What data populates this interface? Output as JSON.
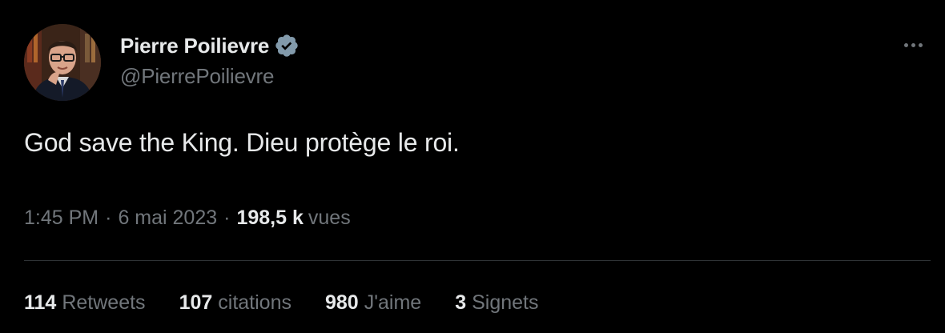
{
  "author": {
    "display_name": "Pierre Poilievre",
    "handle": "@PierrePoilievre",
    "verified": true,
    "verified_icon": "verified-badge-icon",
    "avatar_icon": "profile-photo"
  },
  "tweet": {
    "text": "God save the King. Dieu protège le roi."
  },
  "meta": {
    "time": "1:45 PM",
    "separator": "·",
    "date": "6 mai 2023",
    "views_count": "198,5 k",
    "views_label": "vues"
  },
  "stats": [
    {
      "count": "114",
      "label": "Retweets"
    },
    {
      "count": "107",
      "label": "citations"
    },
    {
      "count": "980",
      "label": "J'aime"
    },
    {
      "count": "3",
      "label": "Signets"
    }
  ],
  "colors": {
    "background": "#000000",
    "primary_text": "#e7e9ea",
    "secondary_text": "#71767b",
    "divider": "#2f3336",
    "verified": "#829aab"
  }
}
